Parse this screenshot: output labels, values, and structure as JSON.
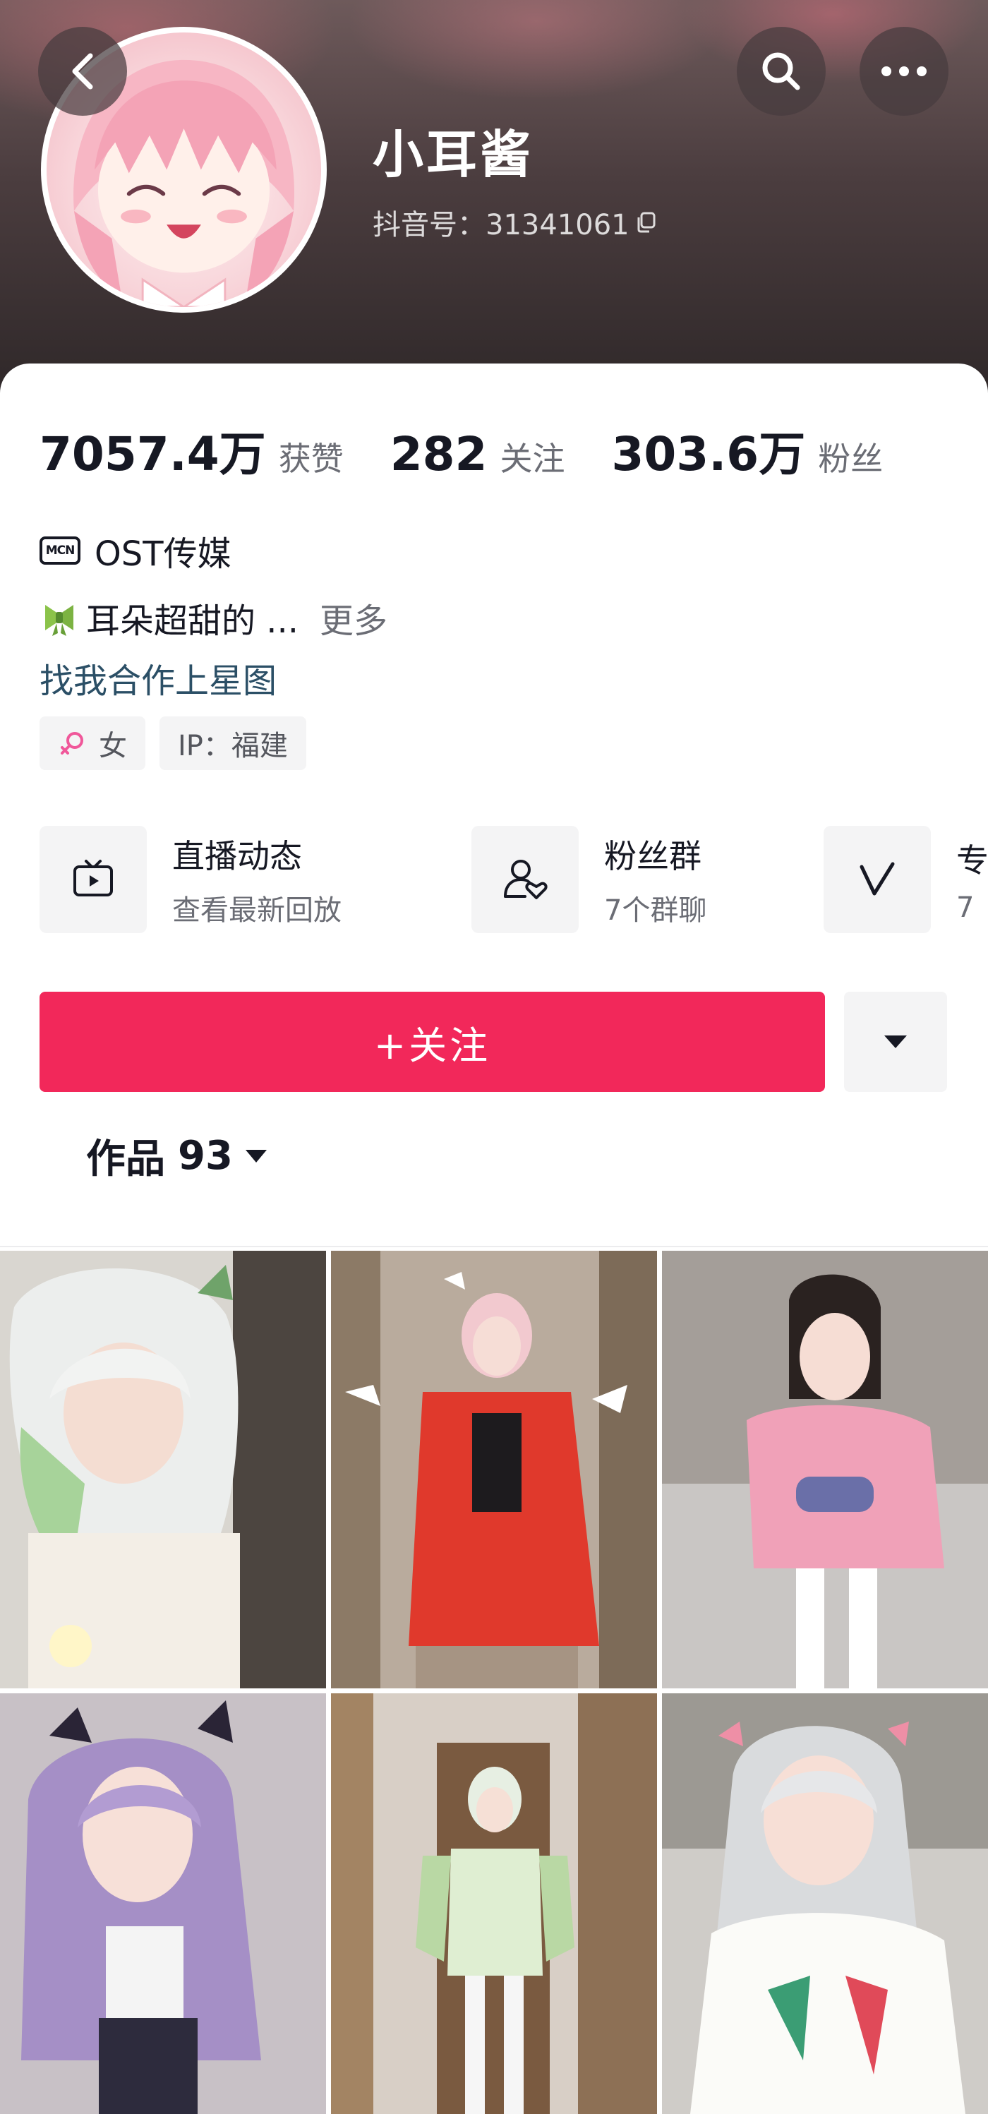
{
  "header": {
    "nickname": "小耳酱",
    "douyin_id": "抖音号：31341061",
    "back_icon": "chevron-left-icon",
    "search_icon": "search-icon",
    "more_icon": "more-horizontal-icon"
  },
  "stats": [
    {
      "value": "7057.4万",
      "label": "获赞"
    },
    {
      "value": "282",
      "label": "关注"
    },
    {
      "value": "303.6万",
      "label": "粉丝"
    }
  ],
  "profile": {
    "mcn_badge": "MCN",
    "mcn_name": "OST传媒",
    "bio": "耳朵超甜的 ...",
    "bio_more": "更多",
    "collab_link": "找我合作上星图",
    "tags": {
      "gender": "女",
      "ip": "IP：福建"
    }
  },
  "features": [
    {
      "title": "直播动态",
      "subtitle": "查看最新回放",
      "icon": "tv-icon"
    },
    {
      "title": "粉丝群",
      "subtitle": "7个群聊",
      "icon": "user-heart-icon"
    },
    {
      "title": "专",
      "subtitle": "7",
      "icon": "check-v-icon"
    }
  ],
  "actions": {
    "follow_label": "+关注"
  },
  "works": {
    "label": "作品",
    "count": "93"
  },
  "colors": {
    "accent": "#f2285a",
    "link": "#2b4f66",
    "text_primary": "#161823",
    "text_secondary": "#6b6d75"
  }
}
